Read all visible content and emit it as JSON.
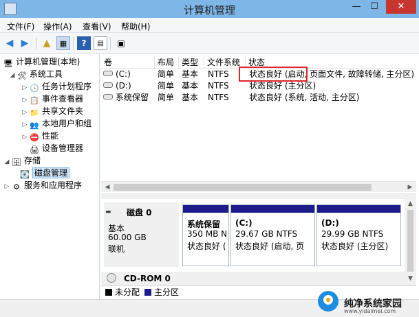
{
  "window": {
    "title": "计算机管理",
    "min_glyph": "—",
    "max_glyph": "☐",
    "close_glyph": "✕",
    "icon": "computer-management-icon"
  },
  "menu": {
    "items": [
      "文件(F)",
      "操作(A)",
      "查看(V)",
      "帮助(H)"
    ]
  },
  "toolbar": {
    "icons": [
      "back-arrow-icon",
      "forward-arrow-icon",
      "up-folder-icon",
      "show-hide-pane-icon",
      "help-icon",
      "properties-icon",
      "document-icon"
    ]
  },
  "tree": {
    "root": "计算机管理(本地)",
    "system_tools": "系统工具",
    "task_scheduler": "任务计划程序",
    "event_viewer": "事件查看器",
    "shared_folders": "共享文件夹",
    "local_users": "本地用户和组",
    "performance": "性能",
    "device_manager": "设备管理器",
    "storage": "存储",
    "disk_management": "磁盘管理",
    "services_apps": "服务和应用程序"
  },
  "volumes": {
    "columns": [
      "卷",
      "布局",
      "类型",
      "文件系统",
      "状态"
    ],
    "rows": [
      [
        "(C:)",
        "简单",
        "基本",
        "NTFS",
        "状态良好 (启动, 页面文件, 故障转储, 主分区)"
      ],
      [
        "(D:)",
        "简单",
        "基本",
        "NTFS",
        "状态良好 (主分区)"
      ],
      [
        "系统保留",
        "简单",
        "基本",
        "NTFS",
        "状态良好 (系统, 活动, 主分区)"
      ]
    ]
  },
  "disk0": {
    "name": "磁盘 0",
    "type": "基本",
    "size": "60.00 GB",
    "state": "联机",
    "partitions": [
      {
        "name": "系统保留",
        "size": "350 MB N",
        "status": "状态良好 ("
      },
      {
        "name": "(C:)",
        "size": "29.67 GB NTFS",
        "status": "状态良好 (启动, 页"
      },
      {
        "name": "(D:)",
        "size": "29.99 GB NTFS",
        "status": "状态良好 (主分区)"
      }
    ]
  },
  "cdrom": {
    "name": "CD-ROM 0"
  },
  "legend": {
    "unallocated": "未分配",
    "primary": "主分区",
    "unallocated_color": "#000000",
    "primary_color": "#1c1c8a"
  },
  "watermark": {
    "text": "纯净系统家园",
    "url": "www.yidaimei.com"
  }
}
